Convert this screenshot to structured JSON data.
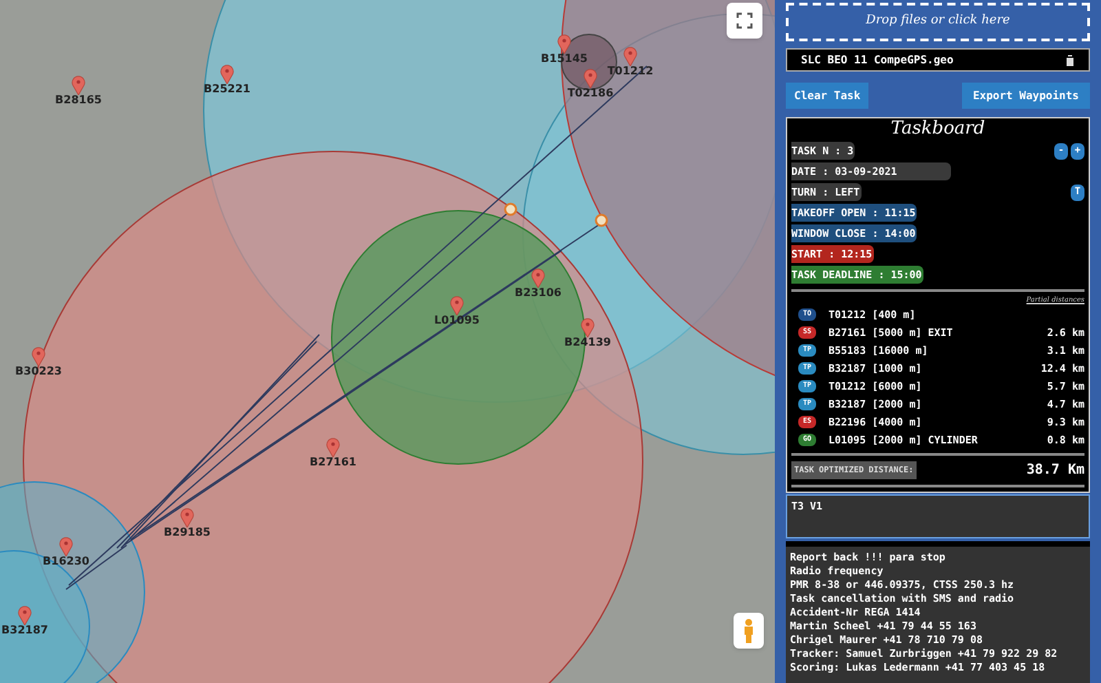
{
  "map": {
    "waypoints": [
      {
        "label": "B28165"
      },
      {
        "label": "B25221"
      },
      {
        "label": "B15145"
      },
      {
        "label": "T01212"
      },
      {
        "label": "T02186"
      },
      {
        "label": "B23106"
      },
      {
        "label": "L01095"
      },
      {
        "label": "B24139"
      },
      {
        "label": "B30223"
      },
      {
        "label": "B27161"
      },
      {
        "label": "B29185"
      },
      {
        "label": "B16230"
      },
      {
        "label": "B32187"
      }
    ]
  },
  "panel": {
    "dropzone": "Drop files or click here",
    "file": {
      "name": "SLC BEO 11 CompeGPS.geo"
    },
    "buttons": [
      "Clear Task",
      "Export Waypoints"
    ],
    "taskboard": {
      "title": "Taskboard",
      "fields": [
        {
          "text": "TASK N : 3",
          "color": "#3a3a3a",
          "buttons": [
            "-",
            "+"
          ]
        },
        {
          "text": "DATE : 03-09-2021",
          "color": "#3a3a3a"
        },
        {
          "text": "TURN : LEFT",
          "color": "#3a3a3a",
          "buttons": [
            "T"
          ]
        },
        {
          "text": "TAKEOFF OPEN : 11:15",
          "color": "#1f4f7e"
        },
        {
          "text": "WINDOW CLOSE : 14:00",
          "color": "#1f4f7e"
        },
        {
          "text": "START : 12:15",
          "color": "#b3261e"
        },
        {
          "text": "TASK DEADLINE : 15:00",
          "color": "#2e7d32"
        }
      ],
      "distances_heading": "Partial distances",
      "turnpoints": [
        {
          "type": "TO",
          "color": "#1f4f8c",
          "name": "T01212 [400 m]"
        },
        {
          "type": "SS",
          "color": "#c62828",
          "name": "B27161 [5000 m] EXIT",
          "distance": "2.6 km"
        },
        {
          "type": "TP",
          "color": "#2a8bc0",
          "name": "B55183 [16000 m]",
          "distance": "3.1 km"
        },
        {
          "type": "TP",
          "color": "#2a8bc0",
          "name": "B32187 [1000 m]",
          "distance": "12.4 km"
        },
        {
          "type": "TP",
          "color": "#2a8bc0",
          "name": "T01212 [6000 m]",
          "distance": "5.7 km"
        },
        {
          "type": "TP",
          "color": "#2a8bc0",
          "name": "B32187 [2000 m]",
          "distance": "4.7 km"
        },
        {
          "type": "ES",
          "color": "#c62828",
          "name": "B22196 [4000 m]",
          "distance": "9.3 km"
        },
        {
          "type": "GO",
          "color": "#2e7d32",
          "name": "L01095 [2000 m] CYLINDER",
          "distance": "0.8 km"
        }
      ],
      "optimized": {
        "label": "TASK OPTIMIZED DISTANCE:",
        "value": "38.7 Km"
      }
    },
    "task_name": {
      "value": "T3 V1"
    },
    "notes": [
      "Report back !!! para stop",
      "Radio frequency",
      "PMR 8-38 or 446.09375, CTSS 250.3 hz",
      "Task cancellation with SMS and radio",
      "Accident-Nr REGA 1414",
      "Martin Scheel +41 79 44 55 163",
      "Chrigel Maurer +41 78 710 79 08",
      "Tracker: Samuel Zurbriggen +41 79 922 29 82",
      "Scoring: Lukas Ledermann +41 77 403 45 18"
    ]
  }
}
